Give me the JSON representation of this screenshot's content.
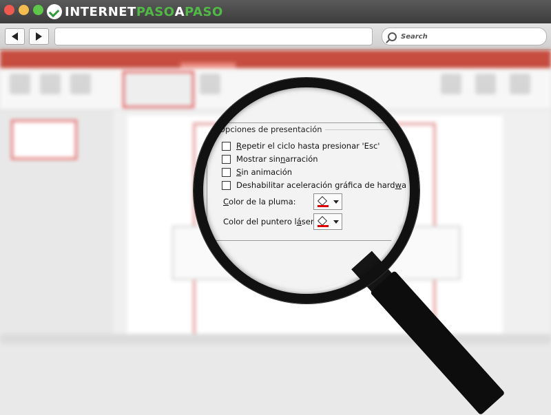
{
  "browser": {
    "logo": {
      "part1": "INTERNET",
      "part2": "PASO",
      "part3": "A",
      "part4": "PASO"
    },
    "search_placeholder": "Search",
    "colors": {
      "logo_green": "#52b948",
      "close": "#ee5a4f",
      "minimize": "#f5bd4f",
      "maximize": "#5fc64a"
    }
  },
  "dialog": {
    "section_title": "Opciones de presentación",
    "options": [
      {
        "pre": "",
        "underline": "R",
        "post": "epetir el ciclo hasta presionar 'Esc'",
        "checked": false
      },
      {
        "pre": "Mostrar sin ",
        "underline": "n",
        "post": "arración",
        "checked": false
      },
      {
        "pre": "",
        "underline": "S",
        "post": "in animación",
        "checked": false
      },
      {
        "pre": "Deshabilitar aceleración gráfica de hard",
        "underline": "w",
        "post": "are",
        "checked": false
      }
    ],
    "pen_color": {
      "pre": "",
      "underline": "C",
      "post": "olor de la pluma:",
      "value": "#e00000"
    },
    "laser_color": {
      "pre": "Color del puntero l",
      "underline": "á",
      "post": "ser:",
      "value": "#e00000"
    }
  }
}
